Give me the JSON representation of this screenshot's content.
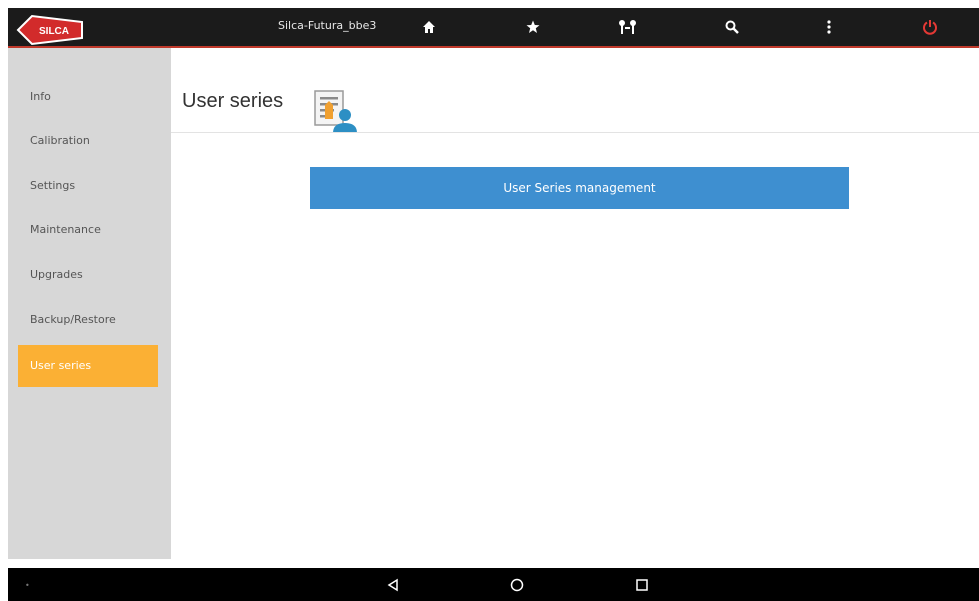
{
  "header": {
    "device_name": "Silca-Futura_bbe3",
    "logo_text": "SILCA",
    "icons": [
      "home-icon",
      "star-icon",
      "keys-icon",
      "search-icon",
      "more-vert-icon",
      "power-icon"
    ],
    "accent_color": "#c0392b"
  },
  "sidebar": {
    "items": [
      {
        "label": "Info",
        "active": false
      },
      {
        "label": "Calibration",
        "active": false
      },
      {
        "label": "Settings",
        "active": false
      },
      {
        "label": "Maintenance",
        "active": false
      },
      {
        "label": "Upgrades",
        "active": false
      },
      {
        "label": "Backup/Restore",
        "active": false
      },
      {
        "label": "User series",
        "active": true
      }
    ],
    "active_color": "#fbb034"
  },
  "main": {
    "title": "User series",
    "title_icon": "user-document-icon",
    "button_label": "User Series management",
    "button_color": "#3e8fd0"
  },
  "navbar": {
    "icons": [
      "back-icon",
      "home-circle-icon",
      "recents-icon"
    ]
  }
}
